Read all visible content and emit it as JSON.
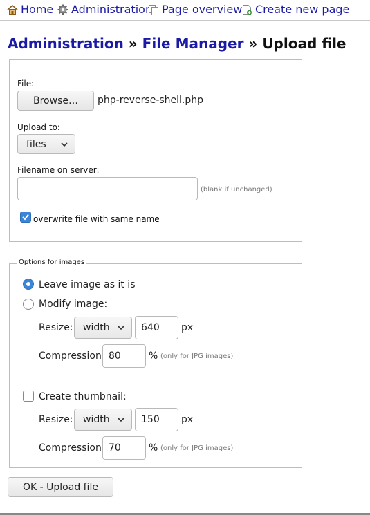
{
  "nav": {
    "home": "Home",
    "administration": "Administration",
    "page_overview": "Page overview",
    "create_new_page": "Create new page"
  },
  "title": {
    "administration": "Administration",
    "sep1": "»",
    "file_manager": "File Manager",
    "sep2": "»",
    "current": "Upload file"
  },
  "upload": {
    "file_label": "File:",
    "browse_label": "Browse…",
    "selected_file": "php-reverse-shell.php",
    "upload_to_label": "Upload to:",
    "upload_to_value": "files",
    "filename_label": "Filename on server:",
    "filename_value": "",
    "filename_hint": "(blank if unchanged)",
    "overwrite_checked": true,
    "overwrite_label": "overwrite file with same name"
  },
  "images": {
    "legend": "Options for images",
    "leave_label": "Leave image as it is",
    "leave_selected": true,
    "modify_label": "Modify image:",
    "modify_selected": false,
    "resize_label": "Resize:",
    "resize_mode": "width",
    "resize_value": "640",
    "resize_unit": "px",
    "compression_label": "Compression:",
    "compression_value": "80",
    "compression_unit": "%",
    "compression_hint": "(only for JPG images)",
    "thumb_label": "Create thumbnail:",
    "thumb_checked": false,
    "thumb_resize_label": "Resize:",
    "thumb_resize_mode": "width",
    "thumb_resize_value": "150",
    "thumb_resize_unit": "px",
    "thumb_compression_label": "Compression:",
    "thumb_compression_value": "70",
    "thumb_compression_unit": "%",
    "thumb_compression_hint": "(only for JPG images)"
  },
  "submit_label": "OK - Upload file",
  "colors": {
    "link": "#1a1aa6",
    "accent": "#3b84d8"
  }
}
